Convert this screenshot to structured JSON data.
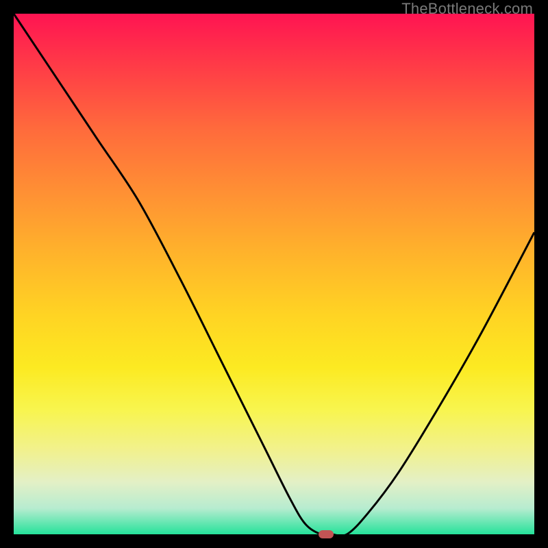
{
  "watermark": "TheBottleneck.com",
  "colors": {
    "curve": "#000000",
    "marker": "#c25455"
  },
  "chart_data": {
    "type": "line",
    "title": "",
    "xlabel": "",
    "ylabel": "",
    "xlim": [
      0,
      100
    ],
    "ylim": [
      0,
      100
    ],
    "series": [
      {
        "name": "bottleneck-curve",
        "x": [
          0,
          8,
          16,
          24,
          32,
          40,
          48,
          53,
          56,
          59,
          61,
          64,
          68,
          74,
          82,
          90,
          100
        ],
        "y": [
          100,
          88,
          76,
          64,
          49,
          33,
          17,
          7,
          2,
          0,
          0,
          0,
          4,
          12,
          25,
          39,
          58
        ]
      }
    ],
    "marker": {
      "x": 60,
      "y": 0
    },
    "annotations": []
  }
}
